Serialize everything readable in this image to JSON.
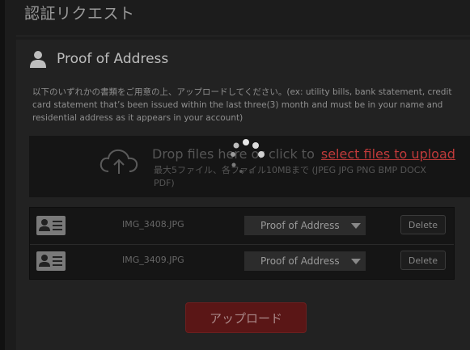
{
  "page": {
    "title": "認証リクエスト"
  },
  "section": {
    "icon": "person-icon",
    "title": "Proof of Address",
    "instructions": "以下のいずれかの書類をご用意の上、アップロードしてください。(ex: utility bills, bank statement, credit card statement that’s been issued within the last three(3) month and must be in your name and residential address as it appears in your account)"
  },
  "dropzone": {
    "icon": "cloud-upload-icon",
    "text_prefix": "Drop files here or click to",
    "link_text": "select files to upload",
    "limits_text": "最大5ファイル、各ファイル10MBまで (JPEG JPG PNG BMP DOCX PDF)"
  },
  "files": [
    {
      "name": "IMG_3408.JPG",
      "doc_type": "Proof of Address",
      "delete_label": "Delete",
      "icon": "id-card-icon"
    },
    {
      "name": "IMG_3409.JPG",
      "doc_type": "Proof of Address",
      "delete_label": "Delete",
      "icon": "id-card-icon"
    }
  ],
  "actions": {
    "upload_label": "アップロード"
  },
  "colors": {
    "accent": "#5a1616",
    "link": "#c03a3a",
    "background": "#1c1c1c"
  }
}
